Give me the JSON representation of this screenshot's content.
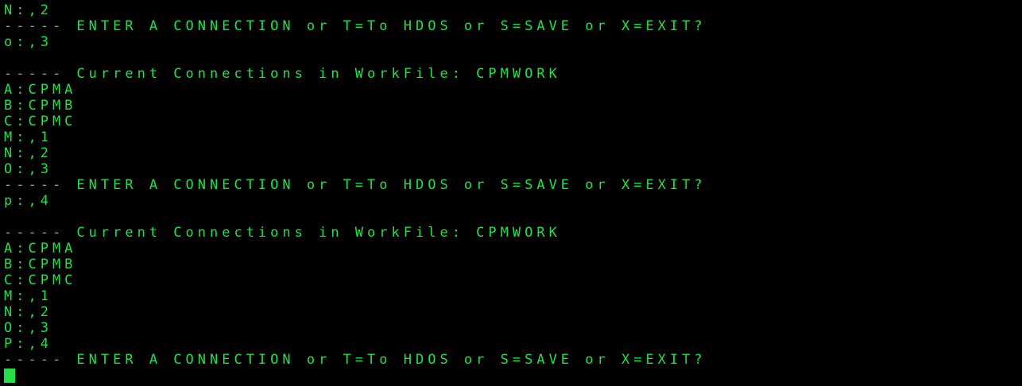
{
  "terminal": {
    "foreground_color": "#22e046",
    "background_color": "#000000",
    "lines": [
      "N:,2",
      "----- ENTER A CONNECTION or T=To HDOS or S=SAVE or X=EXIT?",
      "o:,3",
      "",
      "----- Current Connections in WorkFile: CPMWORK",
      "A:CPMA",
      "B:CPMB",
      "C:CPMC",
      "M:,1",
      "N:,2",
      "O:,3",
      "----- ENTER A CONNECTION or T=To HDOS or S=SAVE or X=EXIT?",
      "p:,4",
      "",
      "----- Current Connections in WorkFile: CPMWORK",
      "A:CPMA",
      "B:CPMB",
      "C:CPMC",
      "M:,1",
      "N:,2",
      "O:,3",
      "P:,4",
      "----- ENTER A CONNECTION or T=To HDOS or S=SAVE or X=EXIT?"
    ],
    "cursor": "block-cursor"
  }
}
